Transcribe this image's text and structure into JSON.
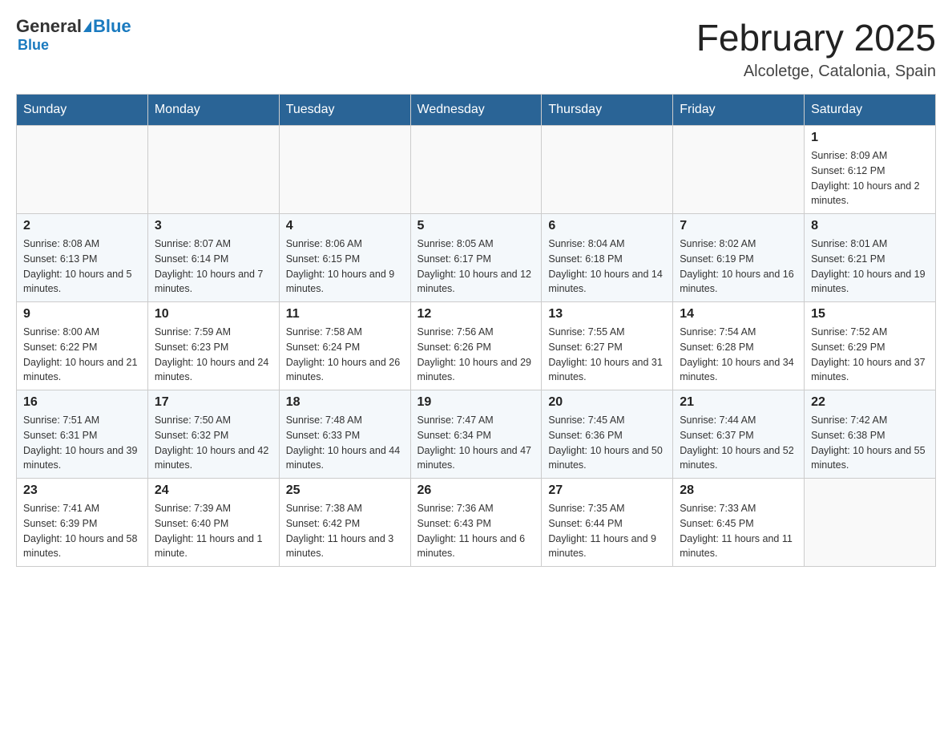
{
  "header": {
    "logo": {
      "general": "General",
      "blue": "Blue"
    },
    "month_title": "February 2025",
    "location": "Alcoletge, Catalonia, Spain"
  },
  "weekdays": [
    "Sunday",
    "Monday",
    "Tuesday",
    "Wednesday",
    "Thursday",
    "Friday",
    "Saturday"
  ],
  "weeks": [
    [
      {
        "day": "",
        "info": ""
      },
      {
        "day": "",
        "info": ""
      },
      {
        "day": "",
        "info": ""
      },
      {
        "day": "",
        "info": ""
      },
      {
        "day": "",
        "info": ""
      },
      {
        "day": "",
        "info": ""
      },
      {
        "day": "1",
        "info": "Sunrise: 8:09 AM\nSunset: 6:12 PM\nDaylight: 10 hours and 2 minutes."
      }
    ],
    [
      {
        "day": "2",
        "info": "Sunrise: 8:08 AM\nSunset: 6:13 PM\nDaylight: 10 hours and 5 minutes."
      },
      {
        "day": "3",
        "info": "Sunrise: 8:07 AM\nSunset: 6:14 PM\nDaylight: 10 hours and 7 minutes."
      },
      {
        "day": "4",
        "info": "Sunrise: 8:06 AM\nSunset: 6:15 PM\nDaylight: 10 hours and 9 minutes."
      },
      {
        "day": "5",
        "info": "Sunrise: 8:05 AM\nSunset: 6:17 PM\nDaylight: 10 hours and 12 minutes."
      },
      {
        "day": "6",
        "info": "Sunrise: 8:04 AM\nSunset: 6:18 PM\nDaylight: 10 hours and 14 minutes."
      },
      {
        "day": "7",
        "info": "Sunrise: 8:02 AM\nSunset: 6:19 PM\nDaylight: 10 hours and 16 minutes."
      },
      {
        "day": "8",
        "info": "Sunrise: 8:01 AM\nSunset: 6:21 PM\nDaylight: 10 hours and 19 minutes."
      }
    ],
    [
      {
        "day": "9",
        "info": "Sunrise: 8:00 AM\nSunset: 6:22 PM\nDaylight: 10 hours and 21 minutes."
      },
      {
        "day": "10",
        "info": "Sunrise: 7:59 AM\nSunset: 6:23 PM\nDaylight: 10 hours and 24 minutes."
      },
      {
        "day": "11",
        "info": "Sunrise: 7:58 AM\nSunset: 6:24 PM\nDaylight: 10 hours and 26 minutes."
      },
      {
        "day": "12",
        "info": "Sunrise: 7:56 AM\nSunset: 6:26 PM\nDaylight: 10 hours and 29 minutes."
      },
      {
        "day": "13",
        "info": "Sunrise: 7:55 AM\nSunset: 6:27 PM\nDaylight: 10 hours and 31 minutes."
      },
      {
        "day": "14",
        "info": "Sunrise: 7:54 AM\nSunset: 6:28 PM\nDaylight: 10 hours and 34 minutes."
      },
      {
        "day": "15",
        "info": "Sunrise: 7:52 AM\nSunset: 6:29 PM\nDaylight: 10 hours and 37 minutes."
      }
    ],
    [
      {
        "day": "16",
        "info": "Sunrise: 7:51 AM\nSunset: 6:31 PM\nDaylight: 10 hours and 39 minutes."
      },
      {
        "day": "17",
        "info": "Sunrise: 7:50 AM\nSunset: 6:32 PM\nDaylight: 10 hours and 42 minutes."
      },
      {
        "day": "18",
        "info": "Sunrise: 7:48 AM\nSunset: 6:33 PM\nDaylight: 10 hours and 44 minutes."
      },
      {
        "day": "19",
        "info": "Sunrise: 7:47 AM\nSunset: 6:34 PM\nDaylight: 10 hours and 47 minutes."
      },
      {
        "day": "20",
        "info": "Sunrise: 7:45 AM\nSunset: 6:36 PM\nDaylight: 10 hours and 50 minutes."
      },
      {
        "day": "21",
        "info": "Sunrise: 7:44 AM\nSunset: 6:37 PM\nDaylight: 10 hours and 52 minutes."
      },
      {
        "day": "22",
        "info": "Sunrise: 7:42 AM\nSunset: 6:38 PM\nDaylight: 10 hours and 55 minutes."
      }
    ],
    [
      {
        "day": "23",
        "info": "Sunrise: 7:41 AM\nSunset: 6:39 PM\nDaylight: 10 hours and 58 minutes."
      },
      {
        "day": "24",
        "info": "Sunrise: 7:39 AM\nSunset: 6:40 PM\nDaylight: 11 hours and 1 minute."
      },
      {
        "day": "25",
        "info": "Sunrise: 7:38 AM\nSunset: 6:42 PM\nDaylight: 11 hours and 3 minutes."
      },
      {
        "day": "26",
        "info": "Sunrise: 7:36 AM\nSunset: 6:43 PM\nDaylight: 11 hours and 6 minutes."
      },
      {
        "day": "27",
        "info": "Sunrise: 7:35 AM\nSunset: 6:44 PM\nDaylight: 11 hours and 9 minutes."
      },
      {
        "day": "28",
        "info": "Sunrise: 7:33 AM\nSunset: 6:45 PM\nDaylight: 11 hours and 11 minutes."
      },
      {
        "day": "",
        "info": ""
      }
    ]
  ]
}
